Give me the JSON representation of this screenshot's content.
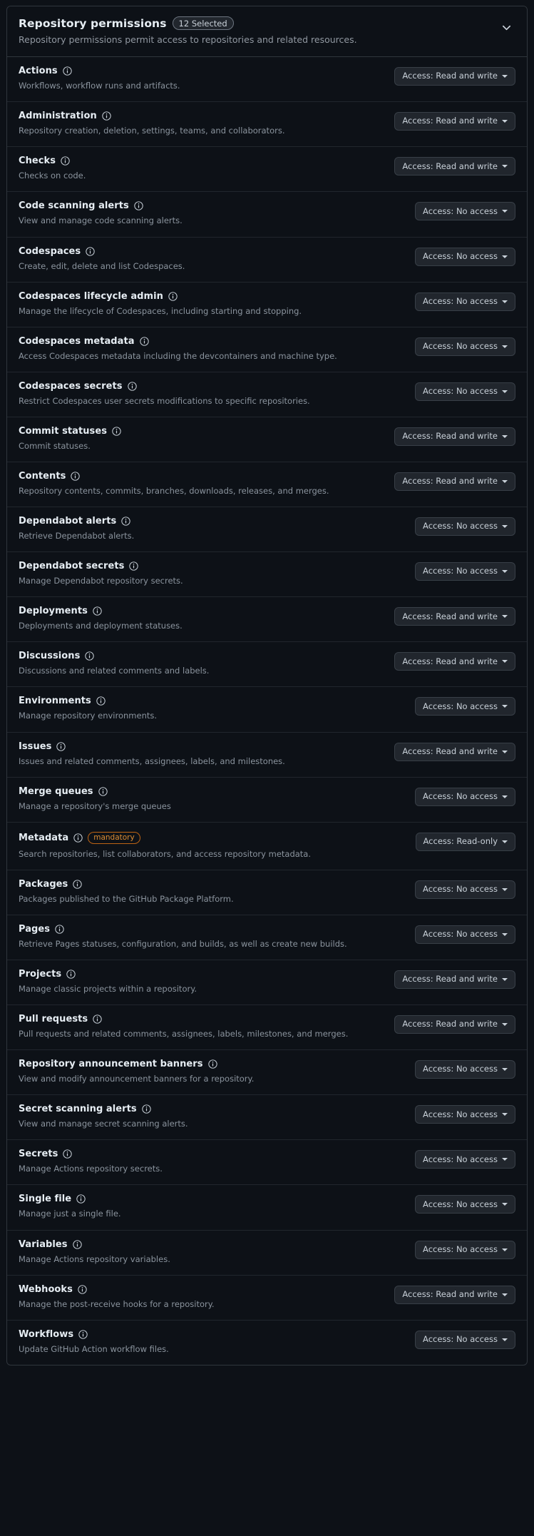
{
  "header": {
    "title": "Repository permissions",
    "badge": "12 Selected",
    "subtitle": "Repository permissions permit access to repositories and related resources.",
    "collapse_icon": "chevron-down-icon"
  },
  "icons": {
    "info": "info-icon",
    "caret": "caret-down-icon"
  },
  "colors": {
    "background": "#0d1117",
    "panel_border": "#30363d",
    "row_divider": "#21262d",
    "title_text": "#e6edf3",
    "muted_text": "#8b949e",
    "button_bg": "#21262d",
    "button_border": "#383f47",
    "mandatory_border": "#bd6414",
    "mandatory_text": "#db8c33"
  },
  "access_labels": {
    "read_write": "Access: Read and write",
    "no_access": "Access: No access",
    "read_only": "Access: Read-only"
  },
  "permissions": [
    {
      "name": "Actions",
      "description": "Workflows, workflow runs and artifacts.",
      "access": "Access: Read and write",
      "mandatory": false
    },
    {
      "name": "Administration",
      "description": "Repository creation, deletion, settings, teams, and collaborators.",
      "access": "Access: Read and write",
      "mandatory": false
    },
    {
      "name": "Checks",
      "description": "Checks on code.",
      "access": "Access: Read and write",
      "mandatory": false
    },
    {
      "name": "Code scanning alerts",
      "description": "View and manage code scanning alerts.",
      "access": "Access: No access",
      "mandatory": false
    },
    {
      "name": "Codespaces",
      "description": "Create, edit, delete and list Codespaces.",
      "access": "Access: No access",
      "mandatory": false
    },
    {
      "name": "Codespaces lifecycle admin",
      "description": "Manage the lifecycle of Codespaces, including starting and stopping.",
      "access": "Access: No access",
      "mandatory": false
    },
    {
      "name": "Codespaces metadata",
      "description": "Access Codespaces metadata including the devcontainers and machine type.",
      "access": "Access: No access",
      "mandatory": false
    },
    {
      "name": "Codespaces secrets",
      "description": "Restrict Codespaces user secrets modifications to specific repositories.",
      "access": "Access: No access",
      "mandatory": false
    },
    {
      "name": "Commit statuses",
      "description": "Commit statuses.",
      "access": "Access: Read and write",
      "mandatory": false
    },
    {
      "name": "Contents",
      "description": "Repository contents, commits, branches, downloads, releases, and merges.",
      "access": "Access: Read and write",
      "mandatory": false
    },
    {
      "name": "Dependabot alerts",
      "description": "Retrieve Dependabot alerts.",
      "access": "Access: No access",
      "mandatory": false
    },
    {
      "name": "Dependabot secrets",
      "description": "Manage Dependabot repository secrets.",
      "access": "Access: No access",
      "mandatory": false
    },
    {
      "name": "Deployments",
      "description": "Deployments and deployment statuses.",
      "access": "Access: Read and write",
      "mandatory": false
    },
    {
      "name": "Discussions",
      "description": "Discussions and related comments and labels.",
      "access": "Access: Read and write",
      "mandatory": false
    },
    {
      "name": "Environments",
      "description": "Manage repository environments.",
      "access": "Access: No access",
      "mandatory": false
    },
    {
      "name": "Issues",
      "description": "Issues and related comments, assignees, labels, and milestones.",
      "access": "Access: Read and write",
      "mandatory": false
    },
    {
      "name": "Merge queues",
      "description": "Manage a repository's merge queues",
      "access": "Access: No access",
      "mandatory": false
    },
    {
      "name": "Metadata",
      "description": "Search repositories, list collaborators, and access repository metadata.",
      "access": "Access: Read-only",
      "mandatory": true,
      "mandatory_label": "mandatory"
    },
    {
      "name": "Packages",
      "description": "Packages published to the GitHub Package Platform.",
      "access": "Access: No access",
      "mandatory": false
    },
    {
      "name": "Pages",
      "description": "Retrieve Pages statuses, configuration, and builds, as well as create new builds.",
      "access": "Access: No access",
      "mandatory": false
    },
    {
      "name": "Projects",
      "description": "Manage classic projects within a repository.",
      "access": "Access: Read and write",
      "mandatory": false
    },
    {
      "name": "Pull requests",
      "description": "Pull requests and related comments, assignees, labels, milestones, and merges.",
      "access": "Access: Read and write",
      "mandatory": false
    },
    {
      "name": "Repository announcement banners",
      "description": "View and modify announcement banners for a repository.",
      "access": "Access: No access",
      "mandatory": false
    },
    {
      "name": "Secret scanning alerts",
      "description": "View and manage secret scanning alerts.",
      "access": "Access: No access",
      "mandatory": false
    },
    {
      "name": "Secrets",
      "description": "Manage Actions repository secrets.",
      "access": "Access: No access",
      "mandatory": false
    },
    {
      "name": "Single file",
      "description": "Manage just a single file.",
      "access": "Access: No access",
      "mandatory": false
    },
    {
      "name": "Variables",
      "description": "Manage Actions repository variables.",
      "access": "Access: No access",
      "mandatory": false
    },
    {
      "name": "Webhooks",
      "description": "Manage the post-receive hooks for a repository.",
      "access": "Access: Read and write",
      "mandatory": false
    },
    {
      "name": "Workflows",
      "description": "Update GitHub Action workflow files.",
      "access": "Access: No access",
      "mandatory": false
    }
  ]
}
